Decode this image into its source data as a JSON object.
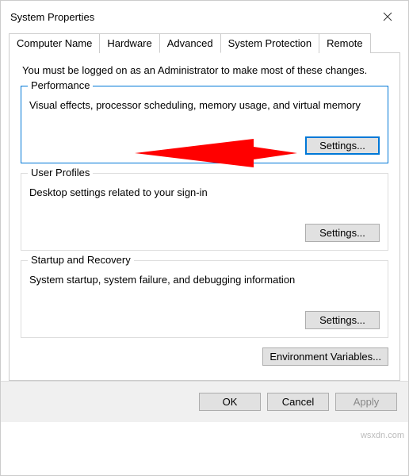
{
  "window": {
    "title": "System Properties"
  },
  "tabs": {
    "items": [
      {
        "label": "Computer Name"
      },
      {
        "label": "Hardware"
      },
      {
        "label": "Advanced"
      },
      {
        "label": "System Protection"
      },
      {
        "label": "Remote"
      }
    ],
    "active_index": 2
  },
  "admin_note": "You must be logged on as an Administrator to make most of these changes.",
  "performance": {
    "title": "Performance",
    "desc": "Visual effects, processor scheduling, memory usage, and virtual memory",
    "button": "Settings..."
  },
  "user_profiles": {
    "title": "User Profiles",
    "desc": "Desktop settings related to your sign-in",
    "button": "Settings..."
  },
  "startup": {
    "title": "Startup and Recovery",
    "desc": "System startup, system failure, and debugging information",
    "button": "Settings..."
  },
  "env_button": "Environment Variables...",
  "dialog": {
    "ok": "OK",
    "cancel": "Cancel",
    "apply": "Apply"
  },
  "watermark": "wsxdn.com",
  "colors": {
    "accent": "#0078d7",
    "arrow": "#ff0000"
  }
}
